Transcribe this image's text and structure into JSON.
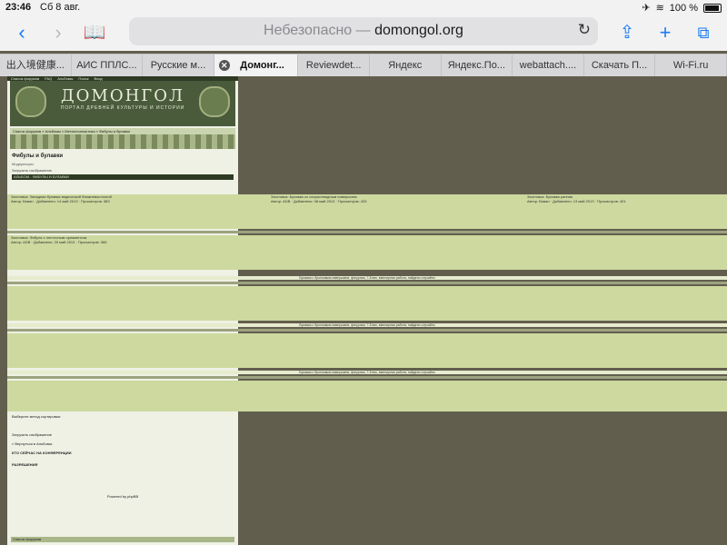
{
  "status_bar": {
    "time": "23:46",
    "date": "Сб 8 авг.",
    "battery": "100 %"
  },
  "address_bar": {
    "prefix": "Небезопасно —",
    "domain": "domongol.org"
  },
  "tabs": [
    {
      "label": "出入境健康..."
    },
    {
      "label": "АИС ППЛС..."
    },
    {
      "label": "Русские м..."
    },
    {
      "label": "Домонг..."
    },
    {
      "label": "Reviewdet..."
    },
    {
      "label": "Яндекс"
    },
    {
      "label": "Яндекс.По..."
    },
    {
      "label": "webattach...."
    },
    {
      "label": "Скачать П..."
    },
    {
      "label": "Wi-Fi.ru"
    }
  ],
  "icons": {
    "back": "chevron-left-icon",
    "forward": "chevron-right-icon",
    "bookmarks": "book-icon",
    "reload": "reload-icon",
    "share": "share-icon",
    "new_tab": "plus-icon",
    "tabs": "tabs-icon",
    "airplane": "airplane-icon",
    "wifi": "wifi-icon",
    "battery": "battery-icon"
  },
  "site": {
    "nav": [
      "Список форумов",
      "FAQ",
      "Альбомы",
      "Поиск",
      "Вход"
    ],
    "logo_title": "ДОМОНГОЛ",
    "logo_subtitle": "ПОРТАЛ ДРЕВНЕЙ КУЛЬТУРЫ И ИСТОРИИ",
    "breadcrumb": "Список форумов » Альбомы » Металлопластика » Фибулы и булавки",
    "page_title": "Фибулы и булавки",
    "moderators": "Модераторы:",
    "upload": "Загрузить изображение",
    "album_header": "АЛЬБОМ - ФИБУЛЫ И БУЛАВКИ",
    "sort_label": "Выберите метод сортировки:",
    "return_link": "« Вернуться в Альбомы",
    "who_is_online": "КТО СЕЙЧАС НА КОНФЕРЕНЦИИ",
    "permissions": "РАЗРЕШЕНИЯ",
    "footer": "Список форумов",
    "powered": "Powered by phpBB"
  },
  "images": [
    {
      "caption": "Заготовка: Западная булавка ведической ближневосточной",
      "meta": "Автор: Вован · Добавлено: 14 май 2013 · Просмотров: 383"
    },
    {
      "caption": "Заготовка: Булавка со спиралевидным навершием",
      "meta": "Автор: ADB · Добавлено: 08 май 2013 · Просмотров: 425"
    },
    {
      "caption": "Заготовка: Булавка ранняя",
      "meta": "Автор: Вован · Добавлено: 13 май 2013 · Просмотров: 401"
    },
    {
      "caption": "Заготовка: Фибула с ленточным орнаментом",
      "meta": "Автор: ADB · Добавлено: 20 май 2013 · Просмотров: 366"
    }
  ],
  "long_caption": "Булавка с бронзовым навершием, фигурная, 7-8 век, ювелирная работа, найдено случайно"
}
